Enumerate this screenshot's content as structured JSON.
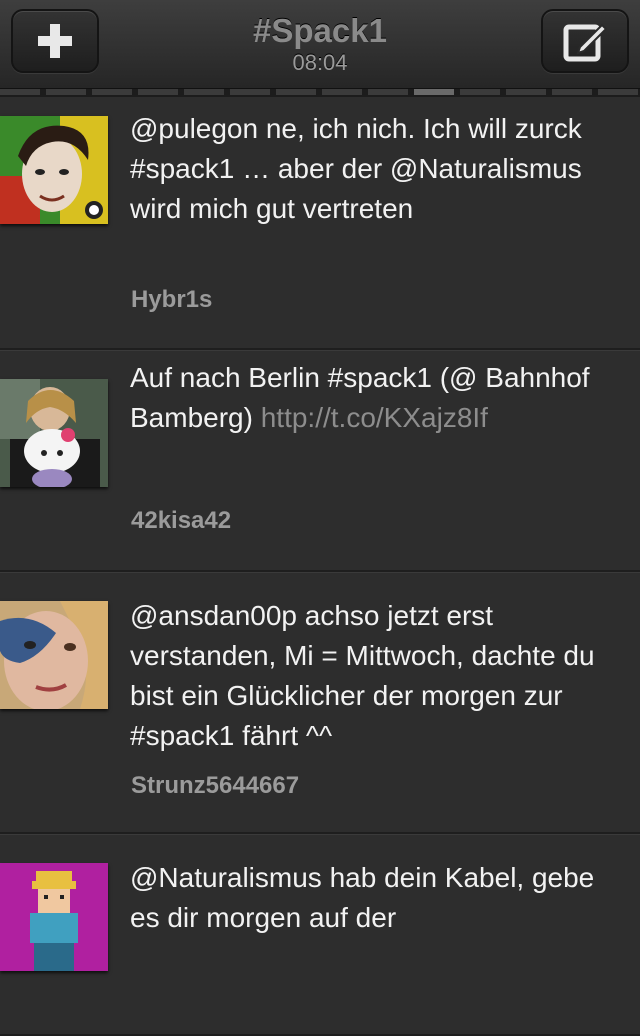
{
  "header": {
    "title": "#Spack1",
    "time": "08:04",
    "add_button_icon": "plus-icon",
    "compose_button_icon": "compose-icon"
  },
  "tweets": [
    {
      "text": "@pulegon ne, ich nich. Ich will zurck #spack1 … aber der @Naturalismus wird mich gut vertreten",
      "link": "",
      "user": "Hybr1s"
    },
    {
      "text": "Auf nach Berlin #spack1 (@ Bahnhof Bamberg) ",
      "link": "http://t.co/KXajz8If",
      "user": "42kisa42"
    },
    {
      "text": "@ansdan00p achso jetzt erst verstanden, Mi = Mittwoch, dachte du bist ein Glücklicher der morgen zur #spack1 fährt ^^",
      "link": "",
      "user": "Strunz5644667"
    },
    {
      "text": "@Naturalismus hab dein Kabel, gebe es dir morgen auf der",
      "link": "",
      "user": ""
    }
  ]
}
